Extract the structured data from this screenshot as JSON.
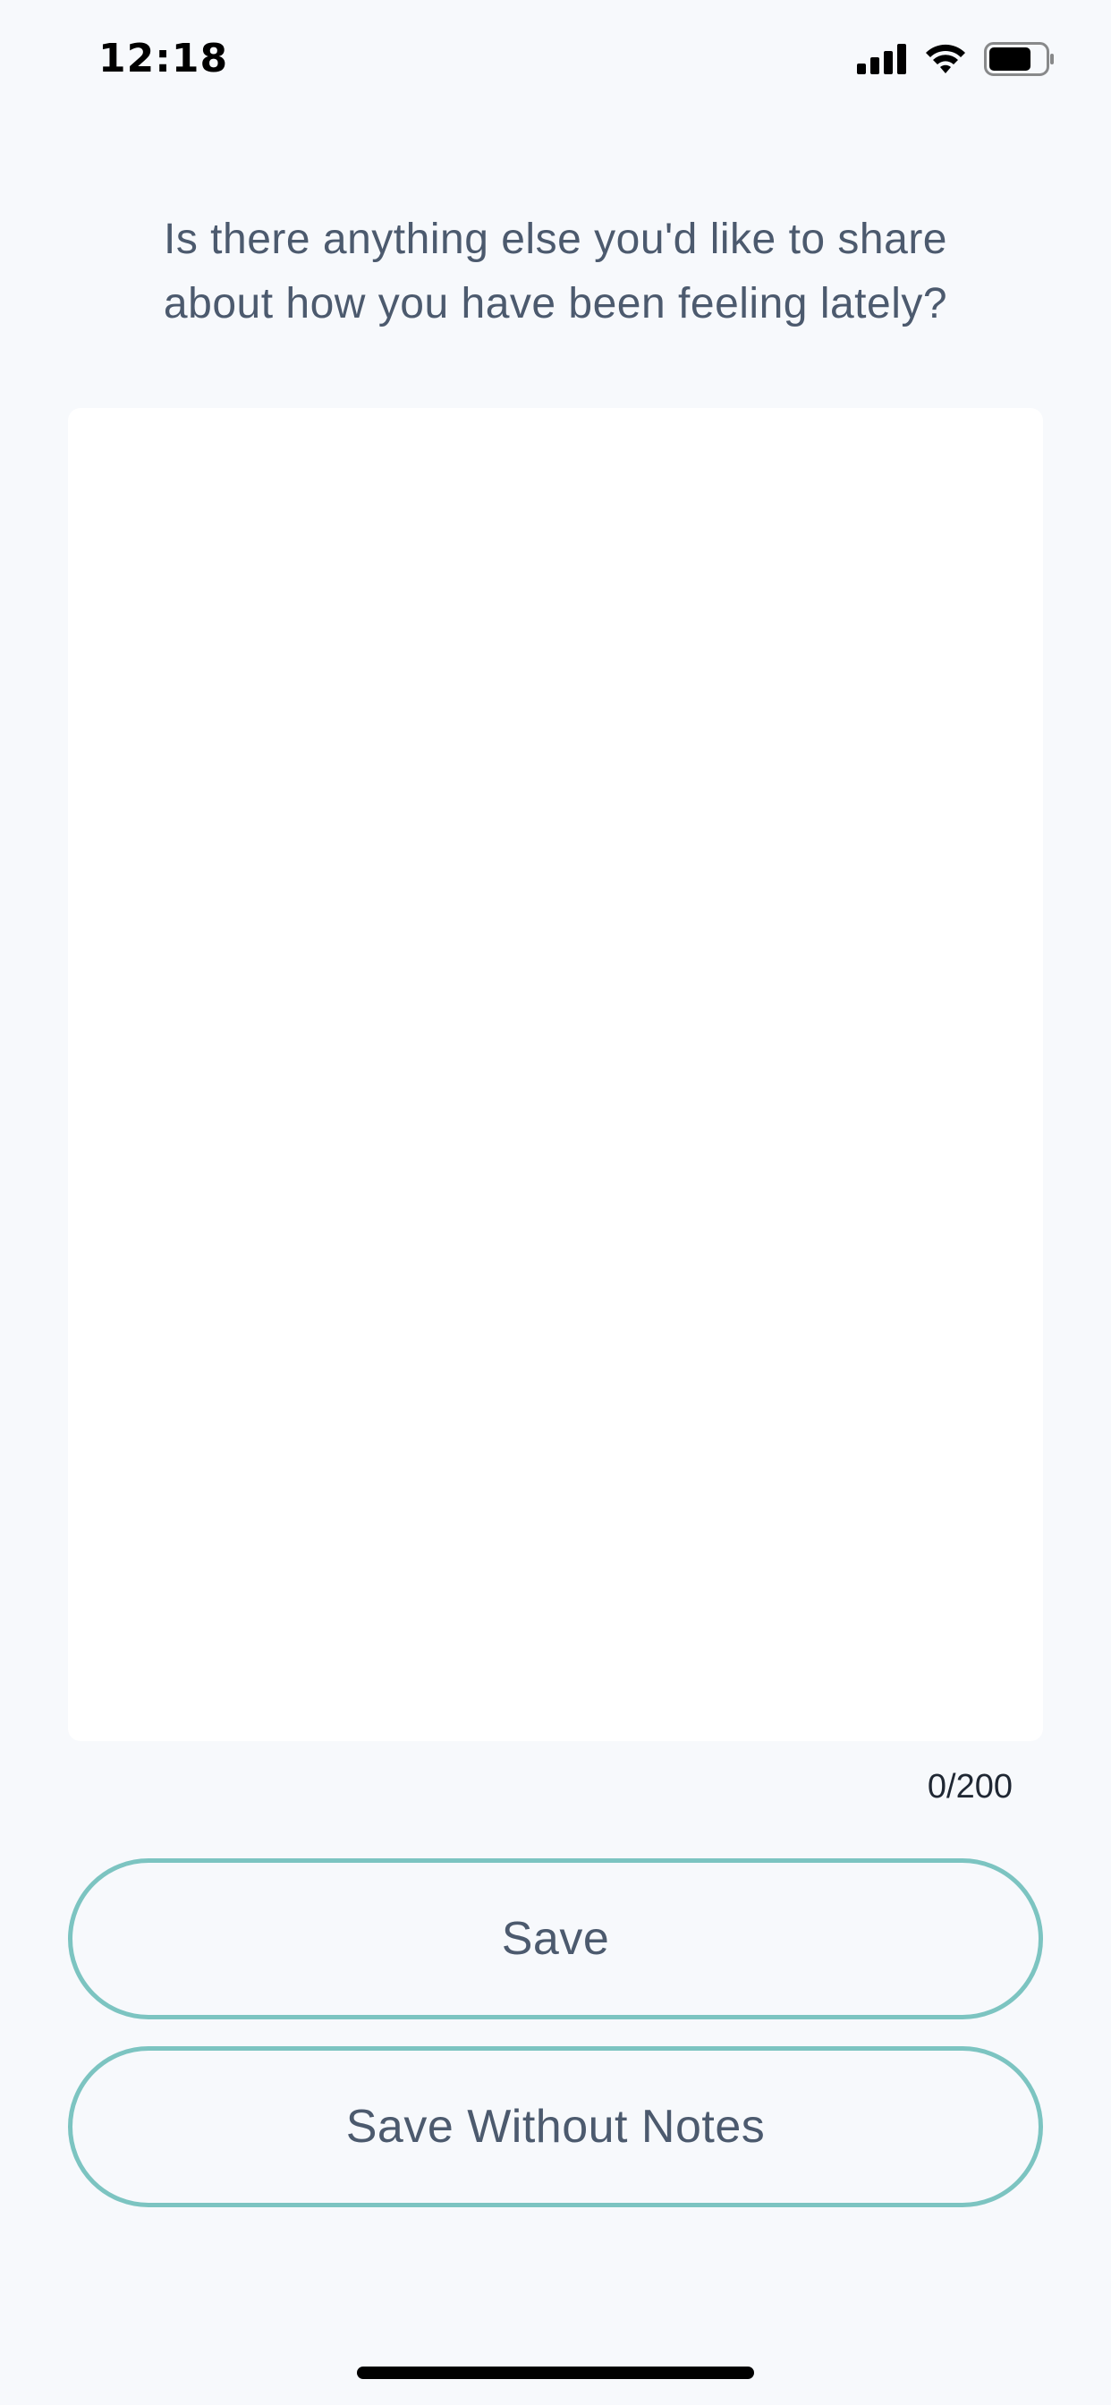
{
  "status_bar": {
    "time": "12:18",
    "icons": [
      "cellular-signal-icon",
      "wifi-icon",
      "battery-icon"
    ]
  },
  "prompt": {
    "line1": "Is there anything else you'd like to share",
    "line2": "about how you have been feeling lately?"
  },
  "notes": {
    "value": "",
    "counter": "0/200"
  },
  "actions": {
    "save_label": "Save",
    "save_without_notes_label": "Save Without Notes"
  },
  "colors": {
    "background": "#f7f9fc",
    "accent": "#7cc4c1",
    "text": "#4c5a6e"
  }
}
